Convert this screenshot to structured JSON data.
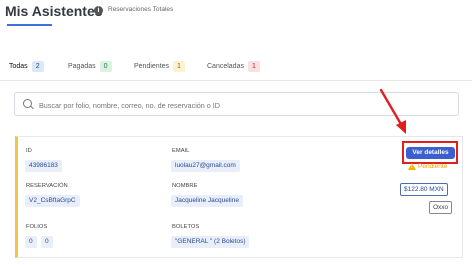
{
  "header": {
    "title": "Mis Asistentes",
    "subtitle": "Reservaciones Totales",
    "info_icon": "i"
  },
  "tabs": [
    {
      "label": "Todas",
      "count": "2",
      "count_bg": "#dce7f7",
      "count_color": "#2a4a8c"
    },
    {
      "label": "Pagadas",
      "count": "0",
      "count_bg": "#dcf2e2",
      "count_color": "#2d7a45"
    },
    {
      "label": "Pendientes",
      "count": "1",
      "count_bg": "#fcf2cf",
      "count_color": "#8a6a00"
    },
    {
      "label": "Canceladas",
      "count": "1",
      "count_bg": "#fbe0e0",
      "count_color": "#a33030"
    }
  ],
  "search": {
    "placeholder": "Buscar por folio, nombre, correo, no. de reservación o ID"
  },
  "card": {
    "id_label": "ID",
    "id_value": "43986183",
    "email_label": "EMAIL",
    "email_value": "luolau27@gmail.com",
    "reservacion_label": "RESERVACIÓN",
    "reservacion_value": "V2_CsBftaGrpC",
    "nombre_label": "NOMBRE",
    "nombre_value": "Jacqueline Jacqueline",
    "folios_label": "FOLIOS",
    "folios_values": [
      "0",
      "0"
    ],
    "boletos_label": "BOLETOS",
    "boletos_value": "\"GENERAL \" (2 Boletos)",
    "details_button": "Ver detalles",
    "status": "Pendiente",
    "price": "$122.80 MXN",
    "payment_method": "Oxxo"
  },
  "colors": {
    "accent": "#3b5fcf",
    "annotation_red": "#e02020",
    "pending": "#e0a400",
    "card_border": "#f4c542"
  },
  "icons": [
    "info-icon",
    "search-icon",
    "warning-icon",
    "annotation-arrow"
  ]
}
